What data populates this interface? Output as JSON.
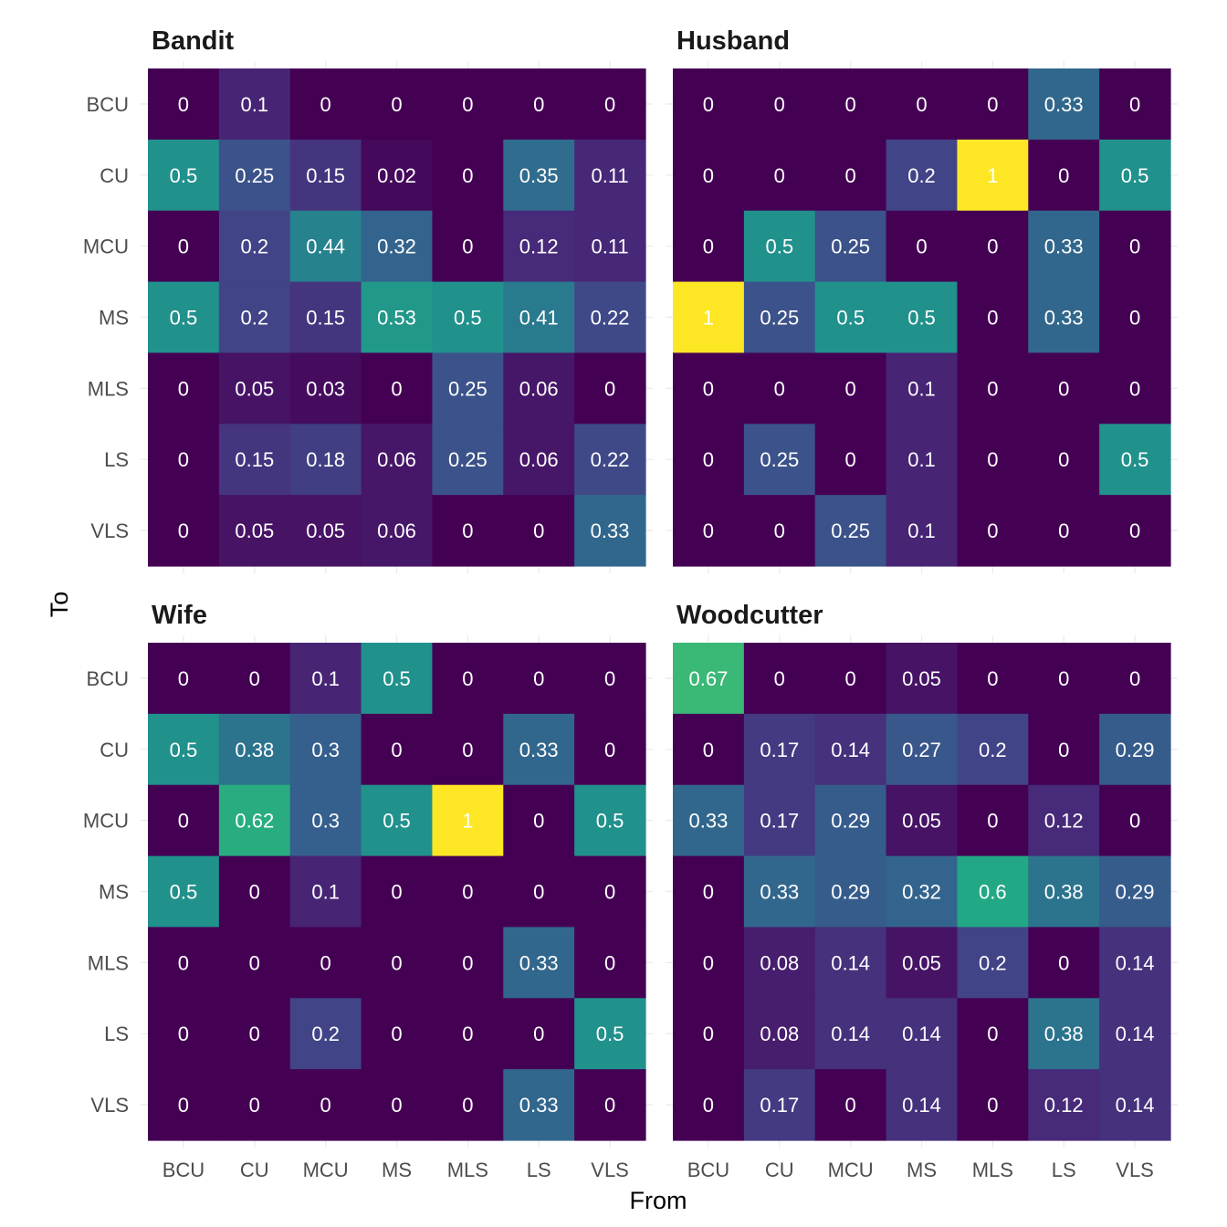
{
  "chart_data": {
    "type": "heatmap",
    "xlabel": "From",
    "ylabel": "To",
    "x_categories": [
      "BCU",
      "CU",
      "MCU",
      "MS",
      "MLS",
      "LS",
      "VLS"
    ],
    "y_categories": [
      "BCU",
      "CU",
      "MCU",
      "MS",
      "MLS",
      "LS",
      "VLS"
    ],
    "color_scale": "viridis",
    "value_range": [
      0,
      1
    ],
    "cell_labels": true,
    "grid": true,
    "legend": "none",
    "panels": [
      {
        "title": "Bandit",
        "values": [
          [
            0,
            0.1,
            0,
            0,
            0,
            0,
            0
          ],
          [
            0.5,
            0.25,
            0.15,
            0.02,
            0,
            0.35,
            0.11
          ],
          [
            0,
            0.2,
            0.44,
            0.32,
            0,
            0.12,
            0.11
          ],
          [
            0.5,
            0.2,
            0.15,
            0.53,
            0.5,
            0.41,
            0.22
          ],
          [
            0,
            0.05,
            0.03,
            0,
            0.25,
            0.06,
            0
          ],
          [
            0,
            0.15,
            0.18,
            0.06,
            0.25,
            0.06,
            0.22
          ],
          [
            0,
            0.05,
            0.05,
            0.06,
            0,
            0,
            0.33
          ]
        ]
      },
      {
        "title": "Husband",
        "values": [
          [
            0,
            0,
            0,
            0,
            0,
            0.33,
            0
          ],
          [
            0,
            0,
            0,
            0.2,
            1,
            0,
            0.5
          ],
          [
            0,
            0.5,
            0.25,
            0,
            0,
            0.33,
            0
          ],
          [
            1,
            0.25,
            0.5,
            0.5,
            0,
            0.33,
            0
          ],
          [
            0,
            0,
            0,
            0.1,
            0,
            0,
            0
          ],
          [
            0,
            0.25,
            0,
            0.1,
            0,
            0,
            0.5
          ],
          [
            0,
            0,
            0.25,
            0.1,
            0,
            0,
            0
          ]
        ]
      },
      {
        "title": "Wife",
        "values": [
          [
            0,
            0,
            0.1,
            0.5,
            0,
            0,
            0
          ],
          [
            0.5,
            0.38,
            0.3,
            0,
            0,
            0.33,
            0
          ],
          [
            0,
            0.62,
            0.3,
            0.5,
            1,
            0,
            0.5
          ],
          [
            0.5,
            0,
            0.1,
            0,
            0,
            0,
            0
          ],
          [
            0,
            0,
            0,
            0,
            0,
            0.33,
            0
          ],
          [
            0,
            0,
            0.2,
            0,
            0,
            0,
            0.5
          ],
          [
            0,
            0,
            0,
            0,
            0,
            0.33,
            0
          ]
        ]
      },
      {
        "title": "Woodcutter",
        "values": [
          [
            0.67,
            0,
            0,
            0.05,
            0,
            0,
            0
          ],
          [
            0,
            0.17,
            0.14,
            0.27,
            0.2,
            0,
            0.29
          ],
          [
            0.33,
            0.17,
            0.29,
            0.05,
            0,
            0.12,
            0
          ],
          [
            0,
            0.33,
            0.29,
            0.32,
            0.6,
            0.38,
            0.29
          ],
          [
            0,
            0.08,
            0.14,
            0.05,
            0.2,
            0,
            0.14
          ],
          [
            0,
            0.08,
            0.14,
            0.14,
            0,
            0.38,
            0.14
          ],
          [
            0,
            0.17,
            0,
            0.14,
            0,
            0.12,
            0.14
          ]
        ]
      }
    ]
  }
}
